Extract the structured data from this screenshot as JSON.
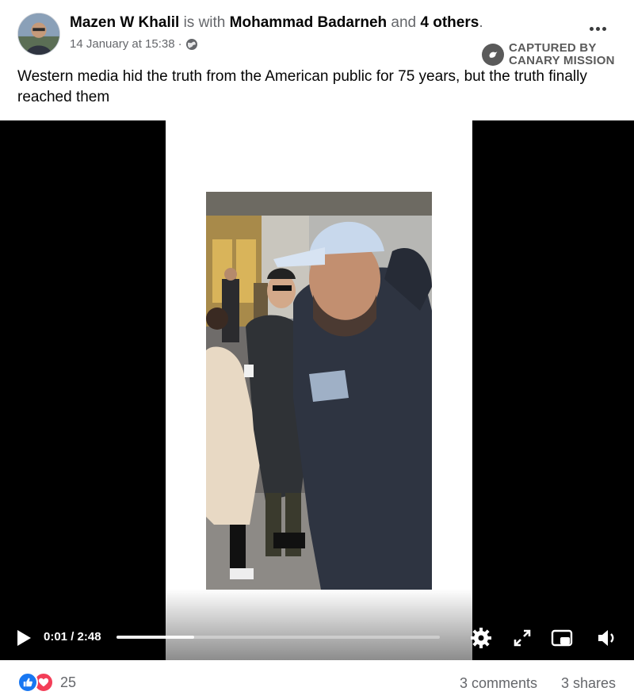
{
  "post": {
    "author": "Mazen W Khalil",
    "with_text": "is with",
    "tagged": "Mohammad Badarneh",
    "and_text": "and",
    "others": "4 others",
    "period": ".",
    "date": "14 January at 15:38",
    "separator": "·",
    "text": "Western media hid the truth from the American public for 75 years, but the truth finally reached them"
  },
  "watermark": {
    "line1": "CAPTURED BY",
    "line2": "CANARY MISSION"
  },
  "video": {
    "time": "0:01 / 2:48",
    "progress": 0.24
  },
  "footer": {
    "reaction_count": "25",
    "comments": "3 comments",
    "shares": "3 shares"
  },
  "icons": {
    "more": "more-options-icon",
    "privacy": "globe-icon",
    "play": "play-icon",
    "settings": "gear-icon",
    "fullscreen": "expand-icon",
    "pip": "picture-in-picture-icon",
    "volume": "volume-icon",
    "like": "like-reaction-icon",
    "love": "love-reaction-icon"
  },
  "colors": {
    "like": "#1877f2",
    "love": "#f33e58",
    "muted": "#65676b"
  }
}
